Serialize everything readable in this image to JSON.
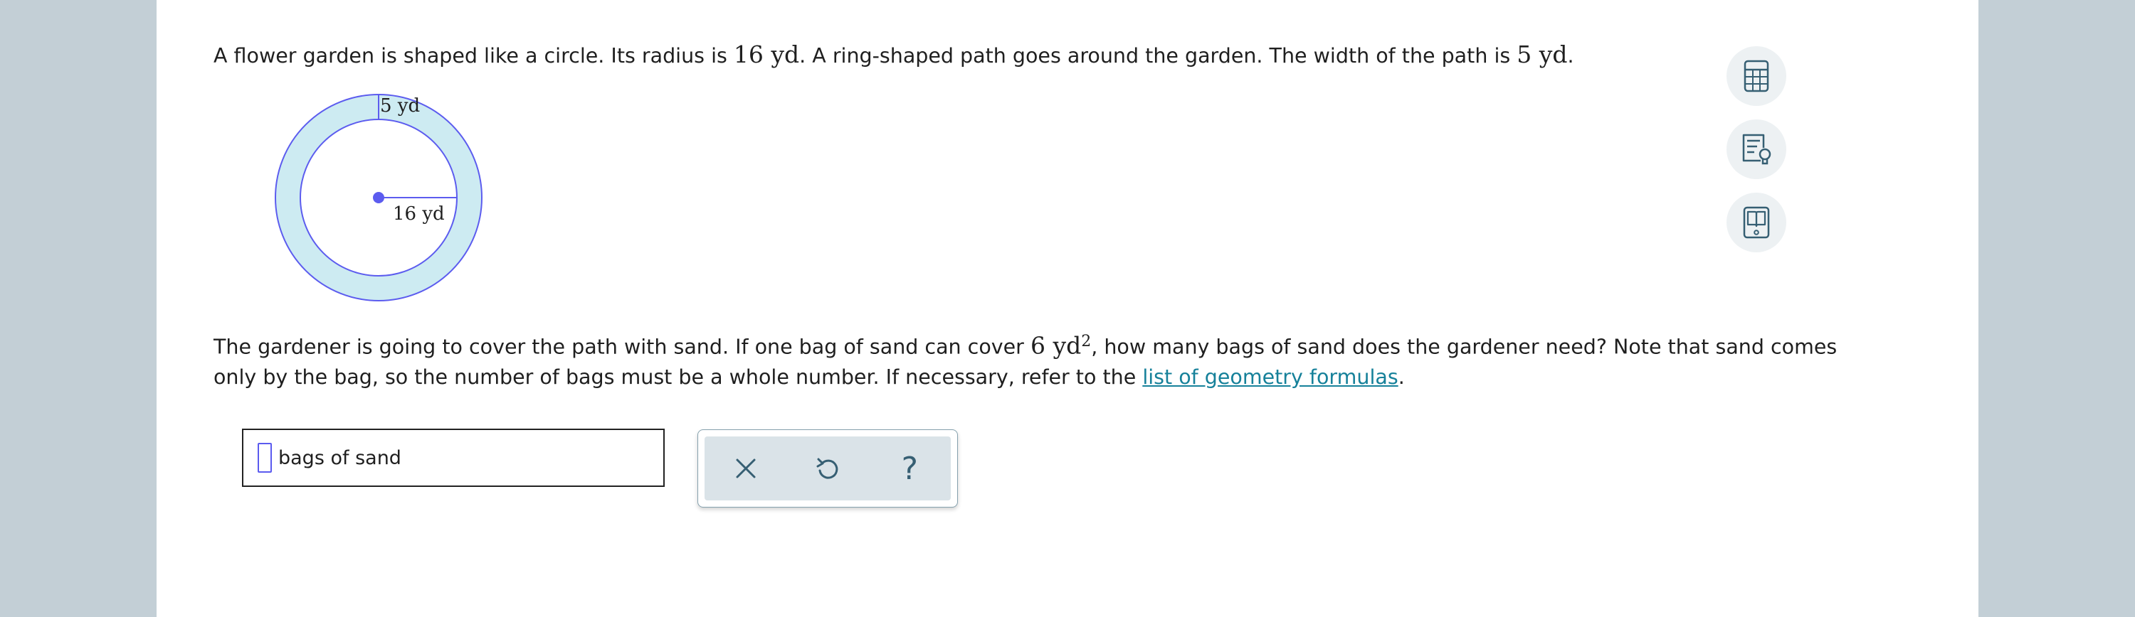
{
  "question": {
    "p1_a": "A flower garden is shaped like a circle. Its radius is ",
    "radius_value": "16 yd",
    "p1_b": ". A ring-shaped path goes around the garden. The width of the path is ",
    "width_value": "5 yd",
    "p1_c": ".",
    "p2_a": "The gardener is going to cover the path with sand. If one bag of sand can cover ",
    "area_value": "6 yd",
    "area_exp": "2",
    "p2_b": ", how many bags of sand does the gardener need? Note that sand comes only by the bag, so the number of bags must be a whole number. If necessary, refer to the ",
    "link_text": "list of geometry formulas",
    "p2_c": "."
  },
  "figure": {
    "width_label": "5 yd",
    "radius_label": "16 yd",
    "colors": {
      "ring_fill": "#cdebf2",
      "stroke": "#5c5cef",
      "inner_fill": "#ffffff"
    }
  },
  "answer": {
    "value": "",
    "unit": "bags of sand"
  },
  "keypad": {
    "clear": "clear-icon",
    "undo": "undo-icon",
    "help": "?"
  },
  "tools": {
    "calculator": "calculator-icon",
    "explanation": "explanation-icon",
    "ebook": "ebook-icon"
  }
}
